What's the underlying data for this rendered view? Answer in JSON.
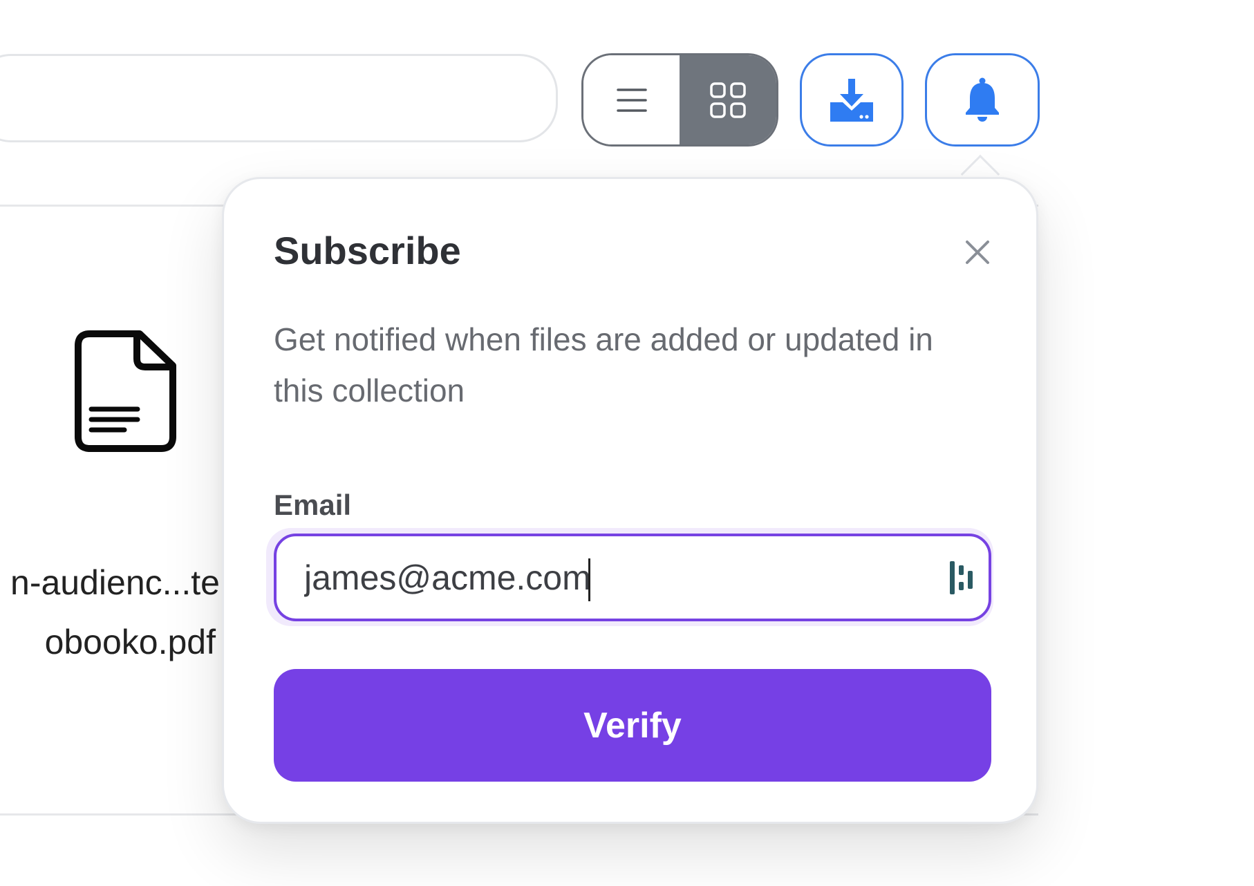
{
  "toolbar": {
    "search": {
      "value": "",
      "placeholder": ""
    },
    "view_toggle": {
      "options": [
        "list",
        "grid"
      ],
      "selected": "grid"
    },
    "icons": {
      "list": "list-icon",
      "grid": "grid-icon",
      "download": "download-icon",
      "notifications": "bell-icon"
    }
  },
  "file": {
    "icon": "document-icon",
    "name_line1": "n-audienc...te",
    "name_line2": "obooko.pdf"
  },
  "subscribe_popover": {
    "title": "Subscribe",
    "description": "Get notified when files are added or updated in this collection",
    "email_label": "Email",
    "email_value": "james@acme.com",
    "submit_label": "Verify",
    "close_icon": "close-icon",
    "password_manager_icon": "password-manager-icon"
  },
  "colors": {
    "accent_purple": "#7640e5",
    "accent_blue": "#3b7de8",
    "toggle_active": "#6f757d"
  }
}
